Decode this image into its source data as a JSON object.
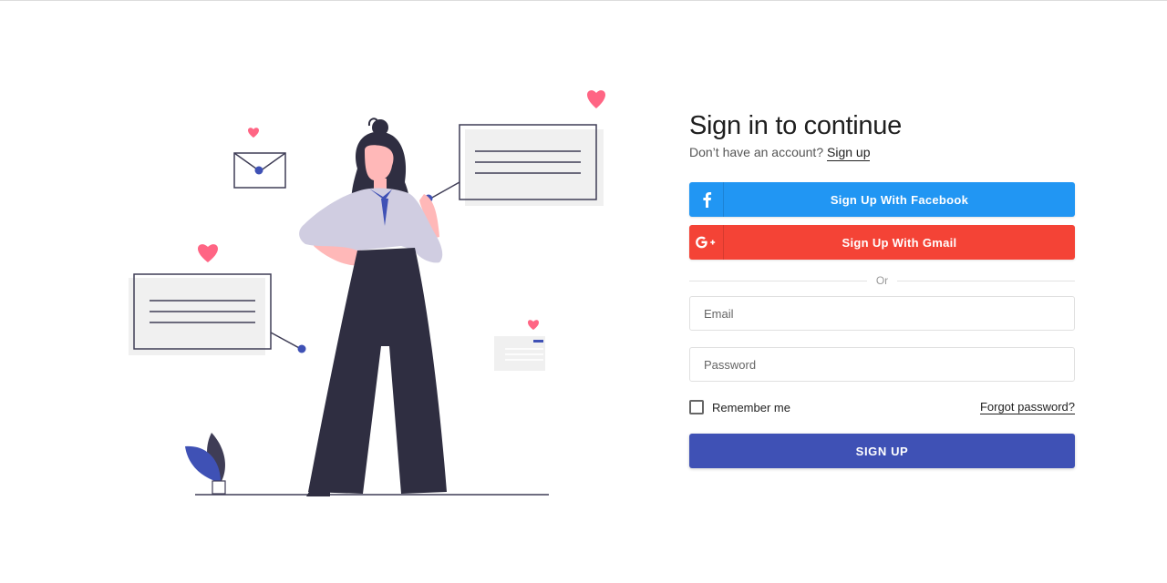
{
  "form": {
    "title": "Sign in to continue",
    "subtitle_prefix": "Don’t have an account?",
    "signup_link": "Sign up",
    "facebook_button": {
      "label": "Sign Up With Facebook",
      "icon": "facebook-icon",
      "color": "#2196f3"
    },
    "gmail_button": {
      "label": "Sign Up With Gmail",
      "icon": "google-plus-icon",
      "color": "#f44336"
    },
    "divider_text": "Or",
    "email": {
      "placeholder": "Email",
      "value": ""
    },
    "password": {
      "placeholder": "Password",
      "value": ""
    },
    "remember_label": "Remember me",
    "remember_checked": false,
    "forgot_link": "Forgot password?",
    "submit_label": "SIGN UP",
    "submit_color": "#3f51b5"
  },
  "illustration": {
    "subject": "woman-with-message-bubbles",
    "accent_color": "#3f51b5",
    "heart_color": "#ff6584"
  }
}
